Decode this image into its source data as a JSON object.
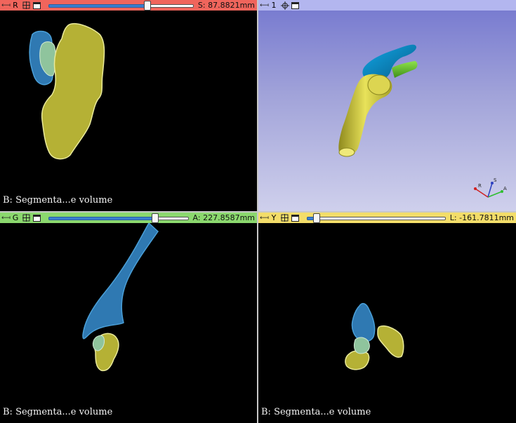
{
  "views": {
    "red": {
      "letter": "R",
      "slice_label": "S: 87.8821mm",
      "slider_fraction": 0.68,
      "caption": "B: Segmenta...e volume",
      "color": "#f0655c"
    },
    "three_d": {
      "number": "1",
      "color": "#b3b6ef",
      "axes": {
        "x_label": "A",
        "y_label": "S",
        "z_label": "R"
      }
    },
    "green": {
      "letter": "G",
      "slice_label": "A: 227.8587mm",
      "slider_fraction": 0.76,
      "caption": "B: Segmenta...e volume",
      "color": "#8bd86e"
    },
    "yellow": {
      "letter": "Y",
      "slice_label": "L: -161.7811mm",
      "slider_fraction": 0.07,
      "caption": "B: Segmenta...e volume",
      "color": "#f3dd69"
    }
  },
  "icons": [
    "pin-icon",
    "link-icon",
    "crosshair-icon",
    "maximize-icon"
  ],
  "segment_colors": {
    "bone": "#b5b135",
    "scapula": "#2f79b2",
    "overlap": "#8fc49d",
    "green_part": "#6fbd3b"
  }
}
